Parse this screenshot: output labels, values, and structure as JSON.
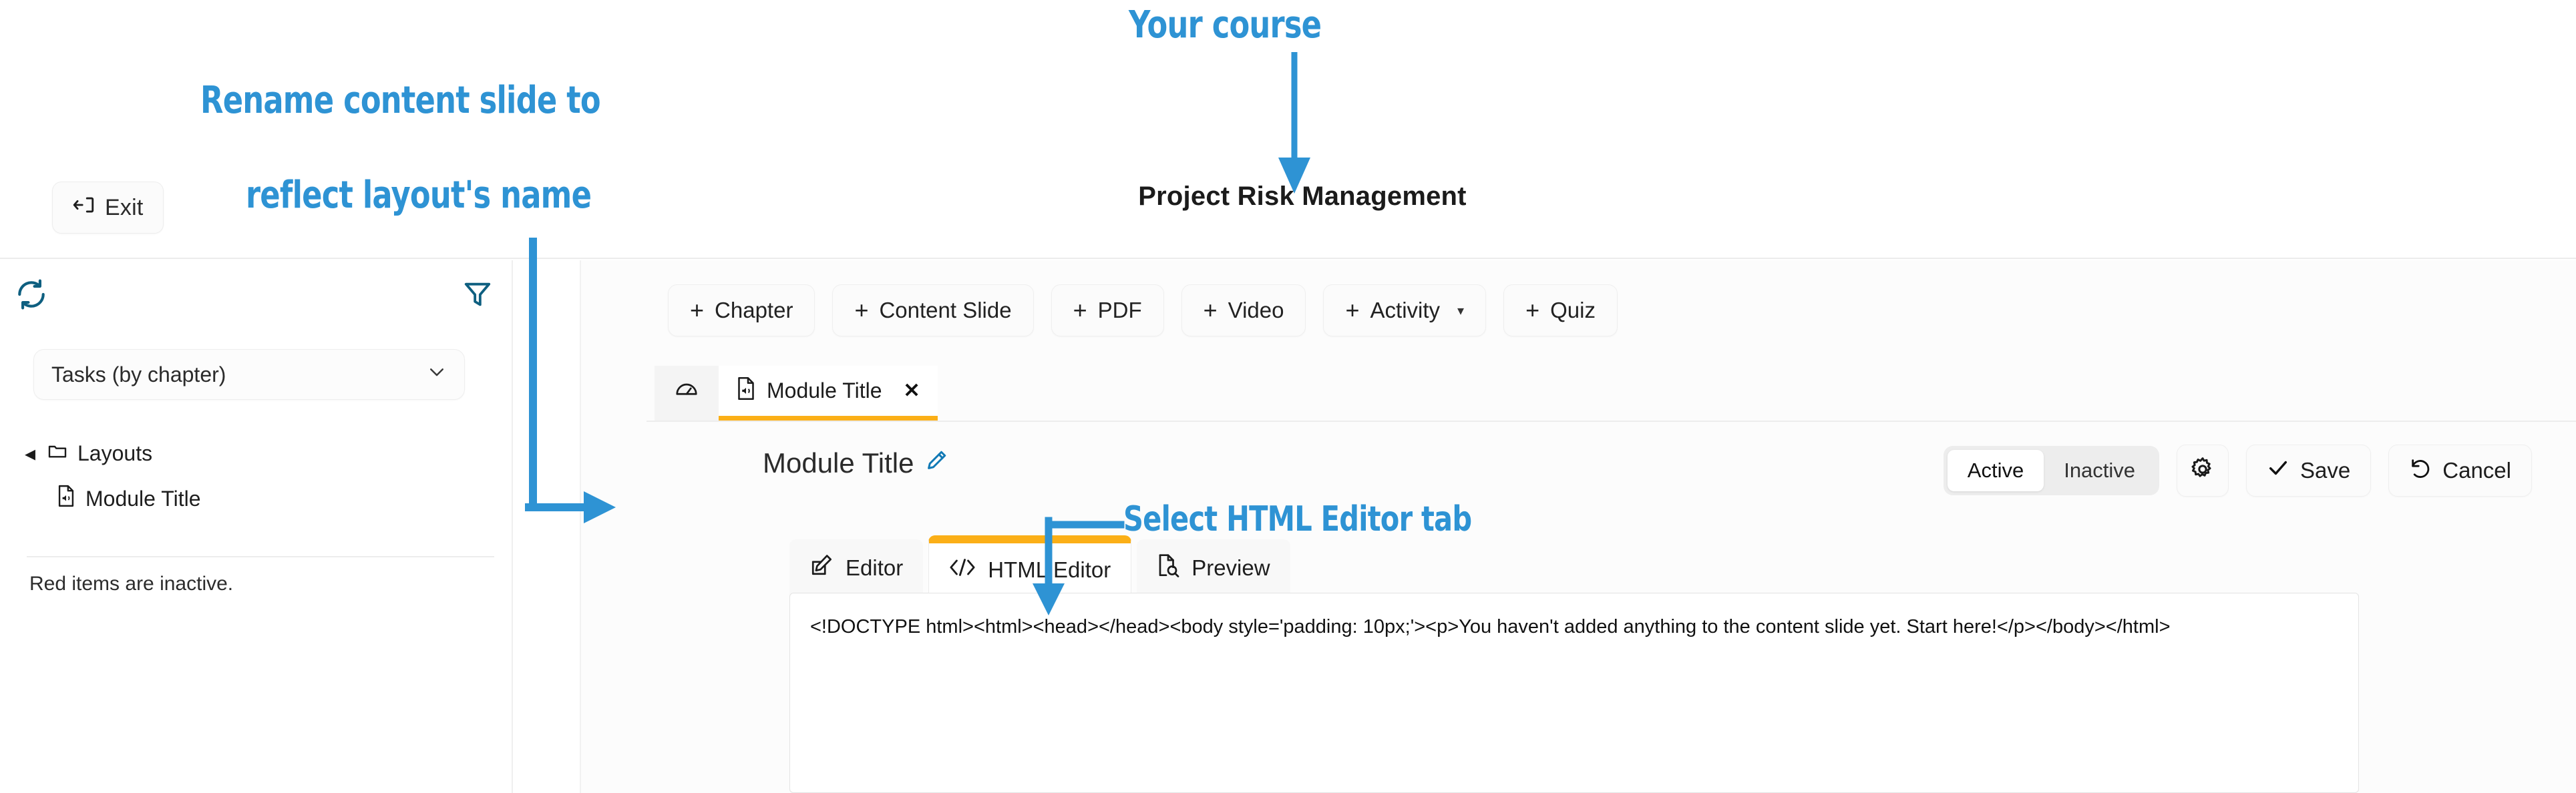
{
  "topbar": {
    "exit_label": "Exit",
    "exit_icon": "exit-arrow-icon",
    "course_title": "Project Risk Management"
  },
  "sidebar": {
    "refresh_icon": "refresh-icon",
    "filter_icon": "filter-icon",
    "select": {
      "value": "Tasks (by chapter)",
      "chevron_icon": "chevron-down-icon"
    },
    "tree": [
      {
        "label": "Layouts",
        "icon": "folder-icon",
        "caret": "◂",
        "level": 0
      },
      {
        "label": "Module Title",
        "icon": "slide-file-icon",
        "level": 1
      }
    ],
    "note": "Red items are inactive."
  },
  "main": {
    "add_buttons": [
      {
        "label": "Chapter",
        "plus": "+"
      },
      {
        "label": "Content Slide",
        "plus": "+"
      },
      {
        "label": "PDF",
        "plus": "+"
      },
      {
        "label": "Video",
        "plus": "+"
      },
      {
        "label": "Activity",
        "plus": "+",
        "caret": "▾"
      },
      {
        "label": "Quiz",
        "plus": "+"
      }
    ],
    "doc_tabs": [
      {
        "label": "",
        "icon": "dashboard-gauge-icon",
        "active": false
      },
      {
        "label": "Module Title",
        "icon": "slide-file-icon",
        "active": true,
        "close": "✕"
      }
    ],
    "slide_title": "Module Title",
    "slide_title_edit_icon": "pencil-edit-icon",
    "status_toggle": {
      "active_label": "Active",
      "inactive_label": "Inactive",
      "selected": "Active"
    },
    "settings_icon": "gear-icon",
    "save_label": "Save",
    "save_icon": "check-icon",
    "cancel_label": "Cancel",
    "cancel_icon": "undo-icon",
    "editor_tabs": [
      {
        "label": "Editor",
        "icon": "pencil-square-icon",
        "active": false
      },
      {
        "label": "HTML Editor",
        "icon": "code-brackets-icon",
        "active": true
      },
      {
        "label": "Preview",
        "icon": "document-search-icon",
        "active": false
      }
    ],
    "code_value": "<!DOCTYPE html><html><head></head><body style='padding: 10px;'><p>You haven't added anything to the content slide yet. Start here!</p></body></html>"
  },
  "annotations": {
    "your_course": "Your course",
    "rename_line1": "Rename content slide to",
    "rename_line2": "reflect layout's name",
    "select_html_editor": "Select HTML Editor tab",
    "color": "#2e93d4"
  },
  "colors": {
    "accent_orange": "#fbaf17",
    "icon_teal": "#0e5f80",
    "annotation_blue": "#2e93d4"
  }
}
